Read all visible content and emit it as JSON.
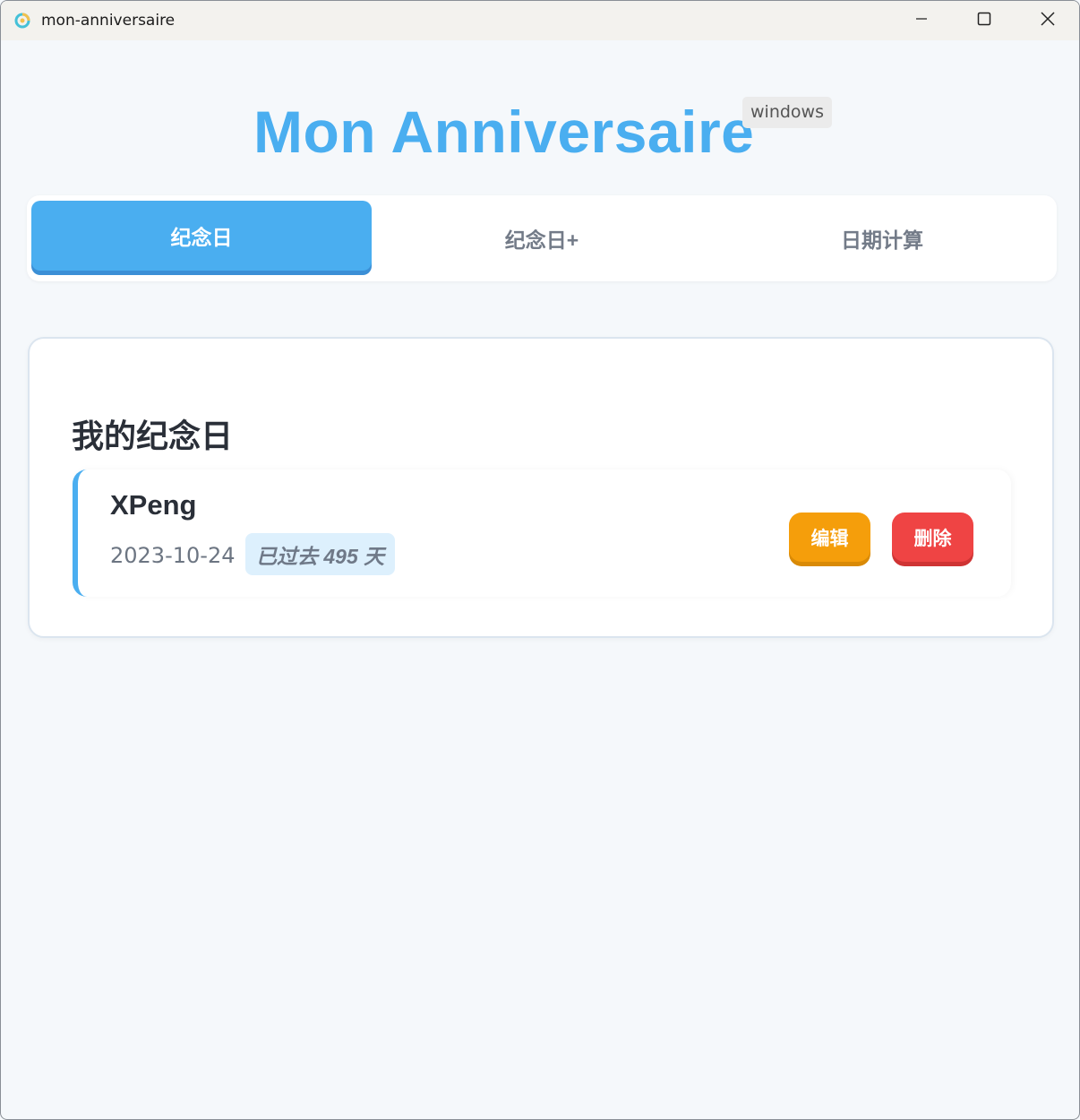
{
  "window": {
    "title": "mon-anniversaire"
  },
  "header": {
    "app_name": "Mon Anniversaire",
    "platform": "windows"
  },
  "tabs": [
    {
      "label": "纪念日",
      "active": true
    },
    {
      "label": "纪念日+",
      "active": false
    },
    {
      "label": "日期计算",
      "active": false
    }
  ],
  "section": {
    "title": "我的纪念日",
    "items": [
      {
        "name": "XPeng",
        "date": "2023-10-24",
        "elapsed": "已过去 495 天",
        "edit_label": "编辑",
        "delete_label": "删除"
      }
    ]
  },
  "colors": {
    "accent": "#4aaef0",
    "edit": "#f59e0b",
    "delete": "#ef4444"
  }
}
